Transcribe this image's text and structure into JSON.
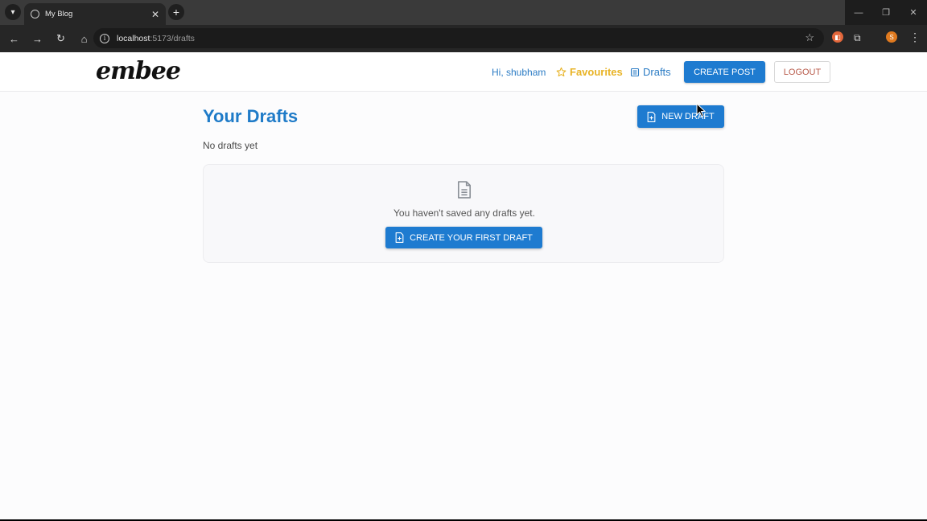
{
  "browser": {
    "tab_title": "My Blog",
    "tab_close": "✕",
    "new_tab": "+",
    "url_host": "localhost",
    "url_path": ":5173/drafts",
    "profile_initial": "S"
  },
  "header": {
    "logo": "embee",
    "greeting": "Hi, shubham",
    "favourites": "Favourites",
    "drafts": "Drafts",
    "create_post": "CREATE POST",
    "logout": "LOGOUT"
  },
  "main": {
    "title": "Your Drafts",
    "new_draft": "NEW DRAFT",
    "subtitle": "No drafts yet",
    "empty_message": "You haven't saved any drafts yet.",
    "create_first": "CREATE YOUR FIRST DRAFT"
  },
  "colors": {
    "accent": "#1e7bd0",
    "title": "#1f7bc8",
    "favourite": "#e8b325",
    "logout": "#b85a4a"
  }
}
